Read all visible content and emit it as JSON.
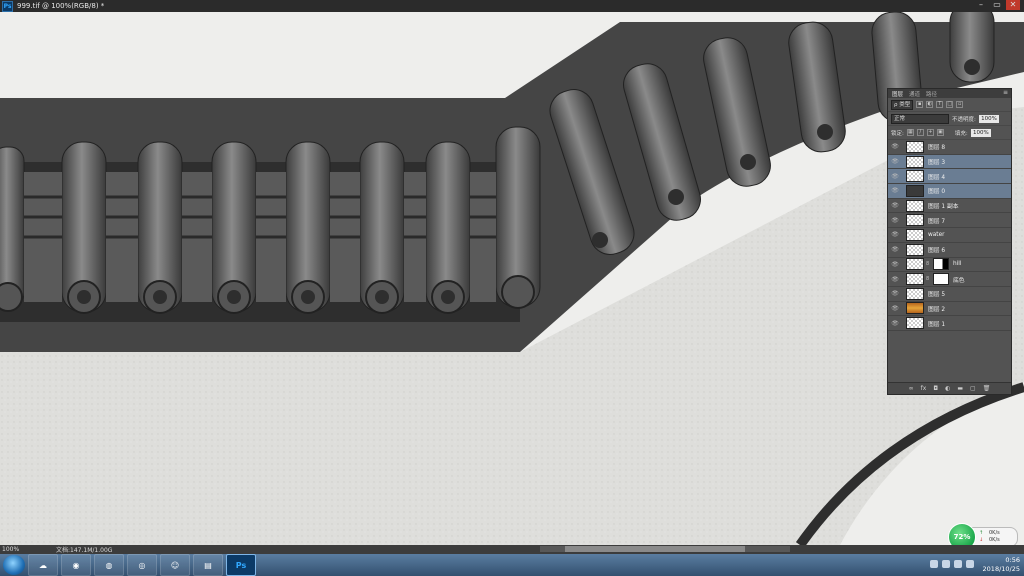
{
  "window": {
    "title": "999.tif @ 100%(RGB/8) *",
    "app_badge": "Ps",
    "controls": [
      "–",
      "▭",
      "✕"
    ]
  },
  "layers_panel": {
    "tabs": [
      "图层",
      "通道",
      "路径"
    ],
    "filter_label": "ρ 类型",
    "blend_mode": "正常",
    "opacity_label": "不透明度:",
    "opacity_value": "100%",
    "lock_label": "锁定:",
    "fill_label": "填充:",
    "fill_value": "100%",
    "layers": [
      {
        "name": "图层 8",
        "selected": false,
        "thumb": "checker"
      },
      {
        "name": "图层 3",
        "selected": true,
        "thumb": "checker"
      },
      {
        "name": "图层 4",
        "selected": true,
        "thumb": "checker"
      },
      {
        "name": "图层 0",
        "selected": true,
        "thumb": "dark"
      },
      {
        "name": "图层 1 副本",
        "selected": false,
        "thumb": "checker"
      },
      {
        "name": "图层 7",
        "selected": false,
        "thumb": "checker"
      },
      {
        "name": "water",
        "selected": false,
        "thumb": "checker"
      },
      {
        "name": "图层 6",
        "selected": false,
        "thumb": "checker"
      },
      {
        "name": "hill",
        "selected": false,
        "thumb": "checker",
        "mask": "bw"
      },
      {
        "name": "底色",
        "selected": false,
        "thumb": "checker",
        "mask": "white"
      },
      {
        "name": "图层 5",
        "selected": false,
        "thumb": "checker"
      },
      {
        "name": "图层 2",
        "selected": false,
        "thumb": "orange"
      },
      {
        "name": "图层 1",
        "selected": false,
        "thumb": "checker"
      }
    ],
    "footer_icons": [
      "link-icon",
      "fx-icon",
      "mask-icon",
      "adjustment-icon",
      "group-icon",
      "new-layer-icon",
      "trash-icon"
    ]
  },
  "statusbar": {
    "zoom": "100%",
    "docinfo": "文档:147.1M/1.00G"
  },
  "speed_widget": {
    "percent": "72%",
    "up": "0K/s",
    "down": "0K/s"
  },
  "taskbar": {
    "apps": [
      "baidu-netdisk",
      "chrome",
      "firefox",
      "browser",
      "user-avatar",
      "explorer",
      "photoshop"
    ],
    "ps_label": "Ps",
    "time": "0:56",
    "date": "2018/10/25"
  },
  "colors": {
    "panel_bg": "#535353",
    "selected_layer": "#6a7d93",
    "titlebar": "#2b2b2b",
    "taskbar": "#33506f"
  }
}
